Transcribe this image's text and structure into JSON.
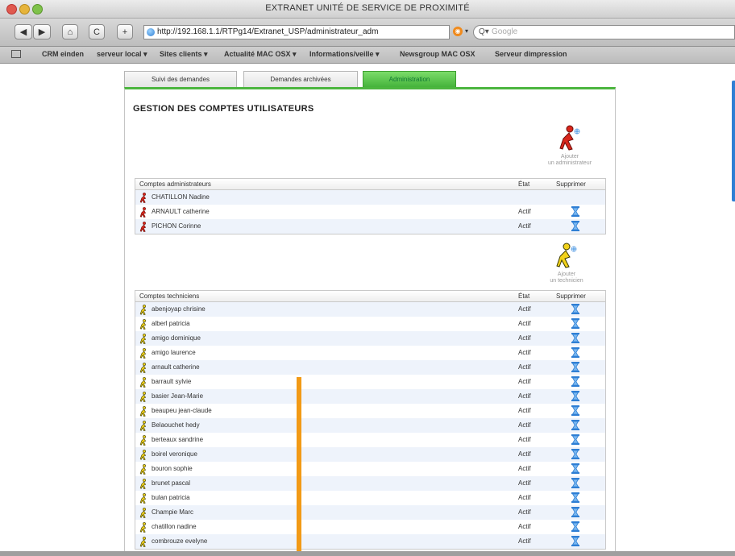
{
  "window": {
    "title": "EXTRANET UNITÉ DE SERVICE DE PROXIMITÉ"
  },
  "toolbar": {
    "back_label": "◀",
    "forward_label": "▶",
    "home_label": "⌂",
    "reload_label": "C",
    "add_label": "+",
    "url": "http://192.168.1.1/RTPg14/Extranet_USP/administrateur_adm",
    "search_placeholder": "Google",
    "search_prefix": "Q▾"
  },
  "bookmarks": [
    "CRM einden",
    "serveur local ▾",
    "Sites clients ▾",
    "Actualité MAC OSX ▾",
    "Informations/veille ▾",
    "Newsgroup MAC OSX",
    "Serveur dimpression"
  ],
  "tabs": [
    "Suivi des demandes",
    "Demandes archivées",
    "Administration"
  ],
  "active_tab": "Administration",
  "page": {
    "title": "GESTION DES COMPTES UTILISATEURS"
  },
  "add_admin": {
    "line1": "Ajouter",
    "line2": "un administrateur"
  },
  "add_tech": {
    "line1": "Ajouter",
    "line2": "un technicien"
  },
  "admins": {
    "header_name": "Comptes administrateurs",
    "header_state": "État",
    "header_delete": "Supprimer",
    "rows": [
      {
        "name": "CHATILLON Nadine",
        "etat": ""
      },
      {
        "name": "ARNAULT catherine",
        "etat": "Actif"
      },
      {
        "name": "PICHON Corinne",
        "etat": "Actif"
      }
    ]
  },
  "techs": {
    "header_name": "Comptes techniciens",
    "header_state": "État",
    "header_delete": "Supprimer",
    "rows": [
      {
        "name": "abenjoyap chrisine",
        "etat": "Actif"
      },
      {
        "name": "alberl patricia",
        "etat": "Actif"
      },
      {
        "name": "amigo dominique",
        "etat": "Actif"
      },
      {
        "name": "amigo laurence",
        "etat": "Actif"
      },
      {
        "name": "arnault catherine",
        "etat": "Actif"
      },
      {
        "name": "barrault sylvie",
        "etat": "Actif"
      },
      {
        "name": "basier Jean-Marie",
        "etat": "Actif"
      },
      {
        "name": "beaupeu jean-claude",
        "etat": "Actif"
      },
      {
        "name": "Belaouchet hedy",
        "etat": "Actif"
      },
      {
        "name": "berteaux sandrine",
        "etat": "Actif"
      },
      {
        "name": "boirel veronique",
        "etat": "Actif"
      },
      {
        "name": "bouron sophie",
        "etat": "Actif"
      },
      {
        "name": "brunet pascal",
        "etat": "Actif"
      },
      {
        "name": "bulan patricia",
        "etat": "Actif"
      },
      {
        "name": "Champie Marc",
        "etat": "Actif"
      },
      {
        "name": "chatillon nadine",
        "etat": "Actif"
      },
      {
        "name": "combrouze evelyne",
        "etat": "Actif"
      }
    ]
  },
  "icons": {
    "admin_user": "red-runner-icon",
    "tech_user": "yellow-runner-icon",
    "delete": "delete-hourglass-icon"
  },
  "colors": {
    "accent_green": "#4cb63f",
    "admin_red": "#d9261c",
    "tech_yellow": "#f2d21a",
    "delete_blue": "#3a8fe0",
    "marker_orange": "#f29a16"
  }
}
